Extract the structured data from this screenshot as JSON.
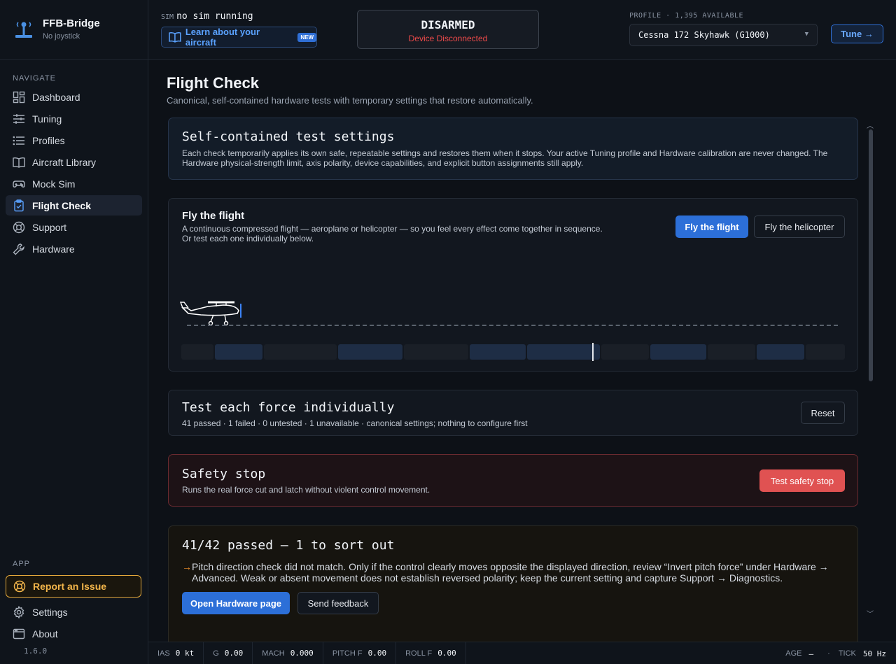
{
  "app": {
    "name": "FFB-Bridge",
    "joystick_status": "No joystick",
    "version": "1.6.0"
  },
  "sidebar": {
    "navigate_header": "NAVIGATE",
    "items": [
      {
        "label": "Dashboard",
        "icon": "dashboard-icon"
      },
      {
        "label": "Tuning",
        "icon": "sliders-icon"
      },
      {
        "label": "Profiles",
        "icon": "list-icon"
      },
      {
        "label": "Aircraft Library",
        "icon": "book-icon"
      },
      {
        "label": "Mock Sim",
        "icon": "gamepad-icon"
      },
      {
        "label": "Flight Check",
        "icon": "clipboard-check-icon",
        "active": true
      },
      {
        "label": "Support",
        "icon": "lifebuoy-icon"
      },
      {
        "label": "Hardware",
        "icon": "wrench-icon"
      }
    ],
    "app_header": "APP",
    "report_issue": "Report an Issue",
    "app_items": [
      {
        "label": "Settings",
        "icon": "gear-icon"
      },
      {
        "label": "About",
        "icon": "window-icon"
      }
    ]
  },
  "header": {
    "sim_tag": "SIM",
    "sim_status": "no sim running",
    "learn_label": "Learn about your aircraft",
    "new_badge": "NEW",
    "arm_state": "DISARMED",
    "device_status": "Device Disconnected",
    "profile_label": "PROFILE · 1,395 AVAILABLE",
    "profile_selected": "Cessna 172 Skyhawk (G1000)",
    "tune_label": "Tune →"
  },
  "page": {
    "title": "Flight Check",
    "subtitle": "Canonical, self-contained hardware tests with temporary settings that restore automatically."
  },
  "settings_card": {
    "title": "Self-contained test settings",
    "text": "Each check temporarily applies its own safe, repeatable settings and restores them when it stops. Your active Tuning profile and Hardware calibration are never changed. The Hardware physical-strength limit, axis polarity, device capabilities, and explicit button assignments still apply."
  },
  "fly_card": {
    "title": "Fly the flight",
    "line1": "A continuous compressed flight — aeroplane or helicopter — so you feel every effect come together in sequence.",
    "line2": "Or test each one individually below.",
    "btn_flight": "Fly the flight",
    "btn_heli": "Fly the helicopter",
    "timeline_progress": 0.62,
    "segments": [
      {
        "w": 46,
        "on": false
      },
      {
        "w": 68,
        "on": true
      },
      {
        "w": 104,
        "on": false
      },
      {
        "w": 92,
        "on": true
      },
      {
        "w": 92,
        "on": false
      },
      {
        "w": 80,
        "on": true
      },
      {
        "w": 104,
        "on": true
      },
      {
        "w": 68,
        "on": false
      },
      {
        "w": 80,
        "on": true
      },
      {
        "w": 68,
        "on": false
      },
      {
        "w": 68,
        "on": true
      },
      {
        "w": 56,
        "on": false
      }
    ]
  },
  "test_card": {
    "title": "Test each force individually",
    "summary": "41 passed · 1 failed · 0 untested · 1 unavailable · canonical settings; nothing to configure first",
    "reset_label": "Reset"
  },
  "safety_card": {
    "title": "Safety stop",
    "text": "Runs the real force cut and latch without violent control movement.",
    "button": "Test safety stop"
  },
  "result_card": {
    "title": "41/42 passed — 1 to sort out",
    "arrow": "→",
    "message": "Pitch direction check did not match. Only if the control clearly moves opposite the displayed direction, review “Invert pitch force” under Hardware → Advanced. Weak or absent movement does not establish reversed polarity; keep the current setting and capture Support → Diagnostics.",
    "btn_hardware": "Open Hardware page",
    "btn_feedback": "Send feedback"
  },
  "statusbar": {
    "ias_label": "IAS",
    "ias_value": "0 kt",
    "g_label": "G",
    "g_value": "0.00",
    "mach_label": "MACH",
    "mach_value": "0.000",
    "pitchf_label": "PITCH F",
    "pitchf_value": "0.00",
    "rollf_label": "ROLL F",
    "rollf_value": "0.00",
    "age_label": "AGE",
    "age_value": "—",
    "sep": "·",
    "tick_label": "TICK",
    "tick_value": "50 Hz"
  },
  "colors": {
    "accent": "#2c6fd8",
    "danger": "#e05252",
    "warning": "#e3a73a",
    "background": "#0d1117"
  }
}
